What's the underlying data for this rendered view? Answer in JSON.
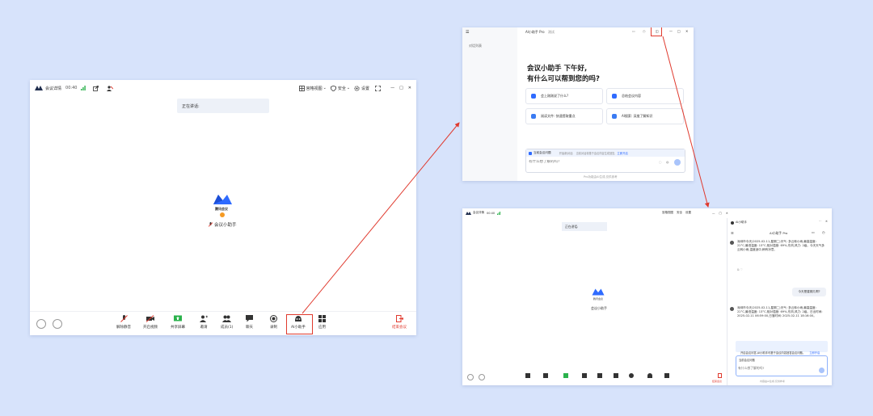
{
  "meeting": {
    "title": "会议详情",
    "time": "00:40",
    "view_label": "宫格视图",
    "security_label": "安全",
    "settings_label": "设置",
    "speaking_label": "正在讲话:",
    "brand": "腾讯会议",
    "participant_name": "会议小助手",
    "toolbar": [
      "解除静音",
      "开启视频",
      "共享屏幕",
      "邀请",
      "成员(1)",
      "聊天",
      "录制",
      "AI小助手",
      "应用"
    ],
    "end_label": "结束会议"
  },
  "ai_window": {
    "title": "AI小助手 Pro",
    "title_suffix": "测试",
    "sidebar_item": "对话列表",
    "greeting_line1": "会议小助手 下午好,",
    "greeting_line2": "有什么可以帮到您的吗?",
    "suggestions": [
      "会上刚刚说了什么?",
      "总结会议内容",
      "阅读文件: 快速提取重点",
      "AI搜索: 深度了解知识"
    ],
    "context_label": "当前会议问题",
    "context_hint": "开始新对话",
    "context_note": "当前对话将基于会议内容生成回复,",
    "context_link": "立即开启",
    "input_placeholder": "有什么想了解的吗?",
    "footer": "Pro功能由AI生成,仅供参考"
  },
  "side_window": {
    "title": "AI小助手",
    "subtitle": "AI小助手 Pro",
    "answer1": "深圳市今天(2025-02-11,星期二)天气: 多云转小雨,最高温度: 22°C,最低温度: 13°C,相对湿度: 69%,东风,风力: 2级。今天天气多云转小雨,温度适中,稍有凉意。",
    "question": "今天是星期几啊?",
    "answer2": "深圳市今天(2025-02-11,星期二)天气: 多云转小雨,最高温度: 22°C,最低温度: 13°C,相对湿度: 69%,东风,风力: 2级。日出时间: 2025-02-11 06:59:00,日落时间: 2025-02-11 18:16:00。",
    "notice": "开启会议问答,AI小助手可基于会议内容回答会议问题。",
    "notice_link": "立即开启",
    "input_placeholder": "有什么想了解的吗?",
    "footer": "内容由AI生成,仅供参考"
  },
  "colors": {
    "accent": "#2f6bff",
    "danger": "#e03a2e",
    "bg": "#d7e3fb"
  }
}
